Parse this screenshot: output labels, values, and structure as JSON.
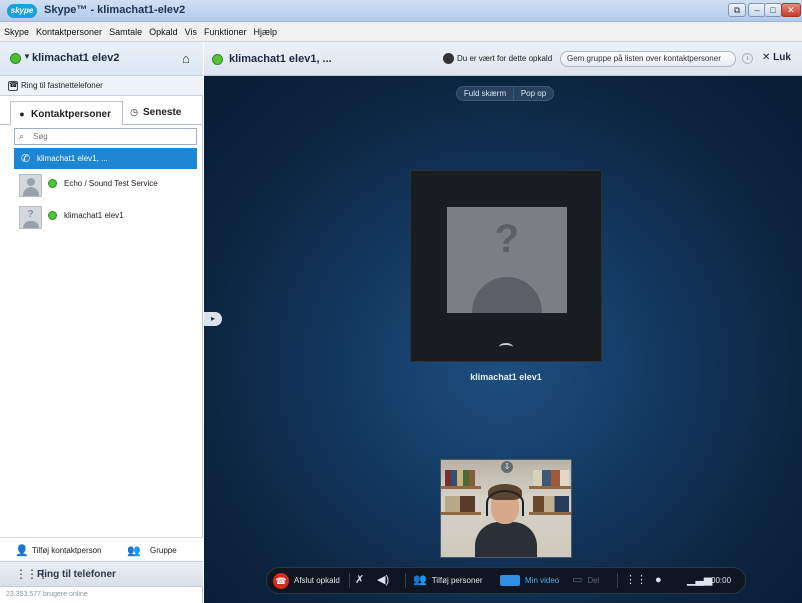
{
  "window": {
    "logo_text": "skype",
    "title": "Skype™ - klimachat1-elev2"
  },
  "menu": [
    "Skype",
    "Kontaktpersoner",
    "Samtale",
    "Opkald",
    "Vis",
    "Funktioner",
    "Hjælp"
  ],
  "profile": {
    "name": "klimachat1 elev2"
  },
  "landline": {
    "label": "Ring til fastnettelefoner"
  },
  "tabs": {
    "contacts": "Kontaktpersoner",
    "recent": "Seneste"
  },
  "search": {
    "placeholder": "Søg"
  },
  "active_call": {
    "label": "klimachat1 elev1, ..."
  },
  "contacts": [
    {
      "name": "Echo / Sound Test Service"
    },
    {
      "name": "klimachat1 elev1"
    }
  ],
  "left_bottom": {
    "add_contact": "Tilføj kontaktperson",
    "group": "Gruppe"
  },
  "ring_phones": "Ring til telefoner",
  "online_count": "23.353.577 brugere online",
  "call_header": {
    "name": "klimachat1 elev1, ...",
    "host_text": "Du er vært for dette opkald",
    "save_group": "Gem gruppe på listen over kontaktpersoner",
    "close": "Luk"
  },
  "stage": {
    "fullscreen": "Fuld skærm",
    "popout": "Pop op",
    "remote_name": "klimachat1 elev1"
  },
  "controls": {
    "hangup": "Afslut opkald",
    "add_people": "Tilføj personer",
    "my_video": "Min video",
    "share": "Del",
    "time": "00:00"
  },
  "colors": {
    "accent": "#1e87d4",
    "hangup": "#d62b1f",
    "online": "#56c23b"
  }
}
